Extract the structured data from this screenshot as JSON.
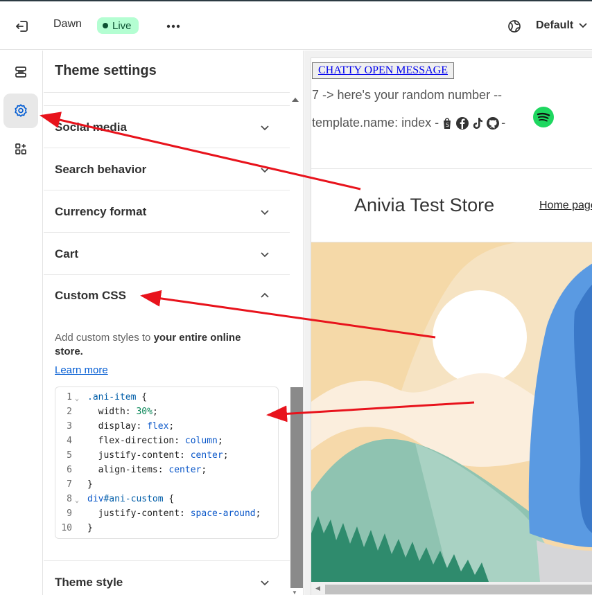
{
  "topbar": {
    "theme_name": "Dawn",
    "live_label": "Live",
    "more_label": "•••",
    "view_label": "Default"
  },
  "panel": {
    "title": "Theme settings",
    "sections": [
      {
        "label": "Social media",
        "expanded": false
      },
      {
        "label": "Search behavior",
        "expanded": false
      },
      {
        "label": "Currency format",
        "expanded": false
      },
      {
        "label": "Cart",
        "expanded": false
      },
      {
        "label": "Custom CSS",
        "expanded": true
      }
    ],
    "custom_css": {
      "description_prefix": "Add custom styles to ",
      "description_bold": "your entire online store.",
      "learn_more": "Learn more",
      "code_lines": [
        {
          "n": "1",
          "fold": true,
          "parts": [
            {
              "t": ".ani-item",
              "c": "sel"
            },
            {
              "t": " {",
              "c": ""
            }
          ]
        },
        {
          "n": "2",
          "fold": false,
          "parts": [
            {
              "t": "  width: ",
              "c": ""
            },
            {
              "t": "30%",
              "c": "num"
            },
            {
              "t": ";",
              "c": ""
            }
          ]
        },
        {
          "n": "3",
          "fold": false,
          "parts": [
            {
              "t": "  display: ",
              "c": ""
            },
            {
              "t": "flex",
              "c": "val"
            },
            {
              "t": ";",
              "c": ""
            }
          ]
        },
        {
          "n": "4",
          "fold": false,
          "parts": [
            {
              "t": "  flex-direction: ",
              "c": ""
            },
            {
              "t": "column",
              "c": "val"
            },
            {
              "t": ";",
              "c": ""
            }
          ]
        },
        {
          "n": "5",
          "fold": false,
          "parts": [
            {
              "t": "  justify-content: ",
              "c": ""
            },
            {
              "t": "center",
              "c": "val"
            },
            {
              "t": ";",
              "c": ""
            }
          ]
        },
        {
          "n": "6",
          "fold": false,
          "parts": [
            {
              "t": "  align-items: ",
              "c": ""
            },
            {
              "t": "center",
              "c": "val"
            },
            {
              "t": ";",
              "c": ""
            }
          ]
        },
        {
          "n": "7",
          "fold": false,
          "parts": [
            {
              "t": "}",
              "c": ""
            }
          ]
        },
        {
          "n": "8",
          "fold": true,
          "parts": [
            {
              "t": "div",
              "c": "tag"
            },
            {
              "t": "#ani-custom",
              "c": "sel"
            },
            {
              "t": " {",
              "c": ""
            }
          ]
        },
        {
          "n": "9",
          "fold": false,
          "parts": [
            {
              "t": "  justify-content: ",
              "c": ""
            },
            {
              "t": "space-around",
              "c": "val"
            },
            {
              "t": ";",
              "c": ""
            }
          ]
        },
        {
          "n": "10",
          "fold": false,
          "parts": [
            {
              "t": "}",
              "c": ""
            }
          ]
        }
      ]
    },
    "theme_style_label": "Theme style"
  },
  "preview": {
    "chatty_button": "CHATTY OPEN MESSAGE",
    "random_text": "7 -> here's your random number --",
    "template_text": "template.name: index -",
    "template_sep": "-",
    "store_name": "Anivia Test Store",
    "nav_home": "Home page"
  },
  "colors": {
    "live_bg": "#b4fed2",
    "live_fg": "#0c5132",
    "link": "#005bd3",
    "annotation_arrow": "#e8131c"
  },
  "icons": [
    "exit-icon",
    "more-icon",
    "globe-icon",
    "chevron-down-icon",
    "sections-icon",
    "gear-icon",
    "apps-icon",
    "chevron-up-icon",
    "shopify-icon",
    "facebook-icon",
    "tiktok-icon",
    "github-icon",
    "spotify-icon"
  ]
}
